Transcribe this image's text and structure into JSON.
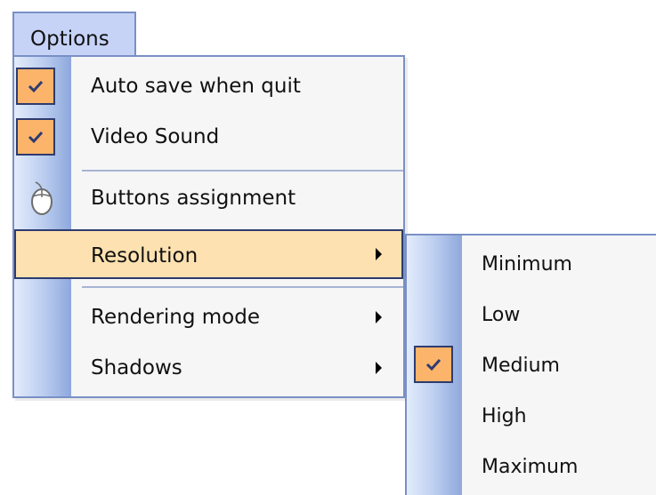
{
  "menubar": {
    "options_label": "Options"
  },
  "menu": {
    "items": [
      {
        "label": "Auto save when quit",
        "checked": true,
        "icon": "checkmark-icon"
      },
      {
        "label": "Video Sound",
        "checked": true,
        "icon": "checkmark-icon"
      },
      {
        "label": "Buttons assignment",
        "icon": "mouse-icon"
      },
      {
        "label": "Resolution",
        "submenu": true,
        "highlighted": true
      },
      {
        "label": "Rendering mode",
        "submenu": true
      },
      {
        "label": "Shadows",
        "submenu": true
      }
    ]
  },
  "resolution_submenu": {
    "items": [
      {
        "label": "Minimum"
      },
      {
        "label": "Low"
      },
      {
        "label": "Medium",
        "checked": true
      },
      {
        "label": "High"
      },
      {
        "label": "Maximum"
      }
    ]
  },
  "colors": {
    "highlight": "#fde1b0",
    "check_background": "#fbb46a",
    "border": "#7990c6",
    "gutter": "#b8cbee"
  }
}
